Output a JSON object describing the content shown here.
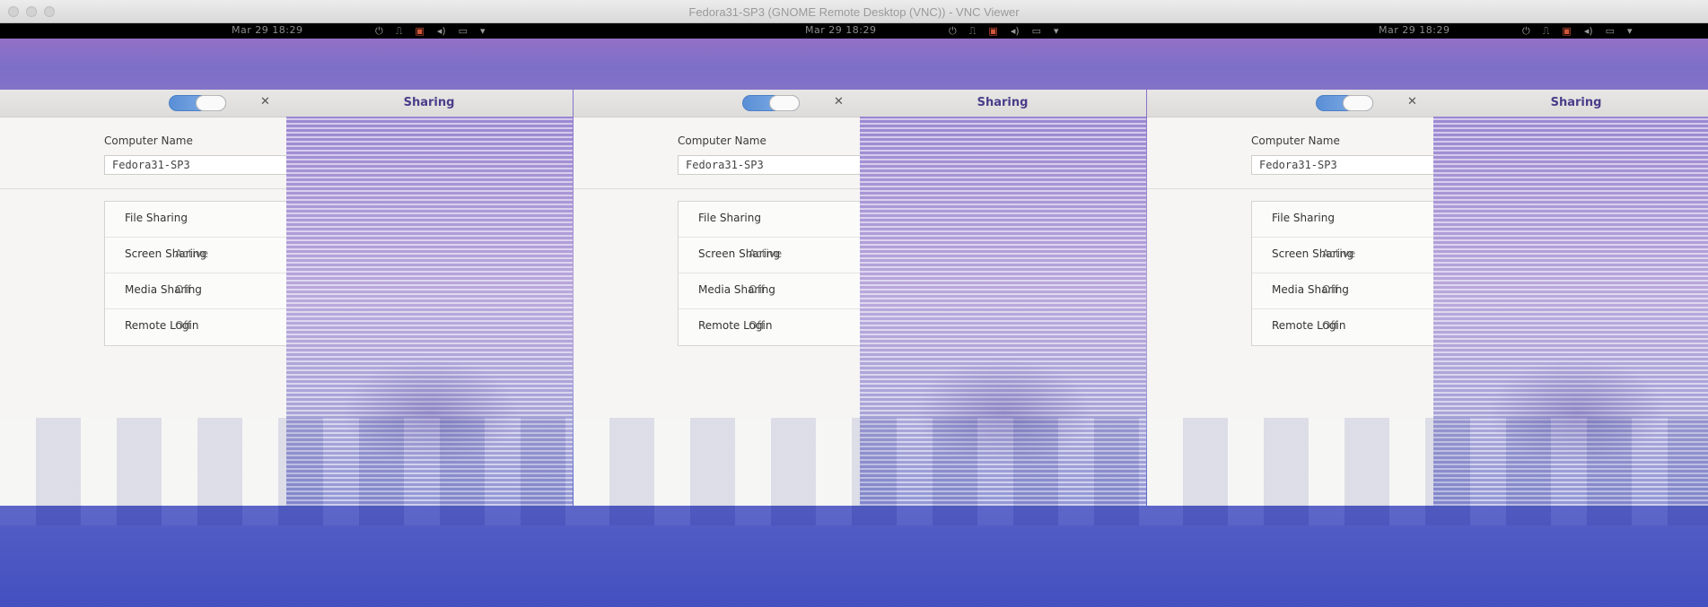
{
  "viewer": {
    "title": "Fedora31-SP3 (GNOME Remote Desktop (VNC)) - VNC Viewer"
  },
  "topbar": {
    "clock": "Mar 29  18:29"
  },
  "sharing": {
    "title": "Sharing",
    "enabled": true,
    "computer_name_label": "Computer Name",
    "computer_name_value": "Fedora31-SP3",
    "items": [
      {
        "label": "File Sharing"
      },
      {
        "label": "Screen Sharing",
        "status": "Active"
      },
      {
        "label": "Media Sharing",
        "status": "Off"
      },
      {
        "label": "Remote Login",
        "status": "Off"
      }
    ]
  },
  "colors": {
    "topbar_bg": "#000000",
    "accent_toggle": "#5a8fd6",
    "window_bg": "#f6f5f4",
    "title_text": "#4a3e8a"
  },
  "icons": [
    "power-icon",
    "network-icon",
    "screencast-icon",
    "volume-icon",
    "battery-icon",
    "chevron-down-icon",
    "close-icon"
  ]
}
